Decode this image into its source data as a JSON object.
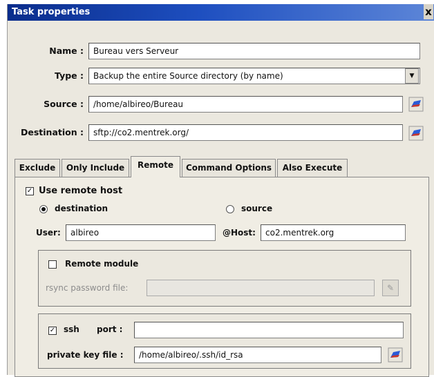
{
  "window": {
    "title": "Task properties",
    "close_label": "x"
  },
  "form": {
    "name_label": "Name :",
    "name_value": "Bureau vers Serveur",
    "type_label": "Type :",
    "type_value": "Backup the entire Source directory (by name)",
    "source_label": "Source :",
    "source_value": "/home/albireo/Bureau",
    "destination_label": "Destination :",
    "destination_value": "sftp://co2.mentrek.org/"
  },
  "tabs": [
    {
      "label": "Exclude",
      "active": false
    },
    {
      "label": "Only Include",
      "active": false
    },
    {
      "label": "Remote",
      "active": true
    },
    {
      "label": "Command Options",
      "active": false
    },
    {
      "label": "Also Execute",
      "active": false
    }
  ],
  "remote": {
    "use_remote_label": "Use remote host",
    "use_remote_checked": true,
    "destination_label": "destination",
    "destination_selected": true,
    "source_label": "source",
    "source_selected": false,
    "user_label": "User:",
    "user_value": "albireo",
    "host_label": "@Host:",
    "host_value": "co2.mentrek.org",
    "remote_module_label": "Remote module",
    "remote_module_checked": false,
    "rsync_password_label": "rsync password file:",
    "rsync_password_value": "",
    "ssh_label": "ssh",
    "ssh_checked": true,
    "port_label": "port :",
    "port_value": "",
    "private_key_label": "private key file :",
    "private_key_value": "/home/albireo/.ssh/id_rsa"
  },
  "colors": {
    "titlebar": "#0a2d8c",
    "window_bg": "#ebe8df",
    "folder_icon": "#2a5bd8"
  }
}
